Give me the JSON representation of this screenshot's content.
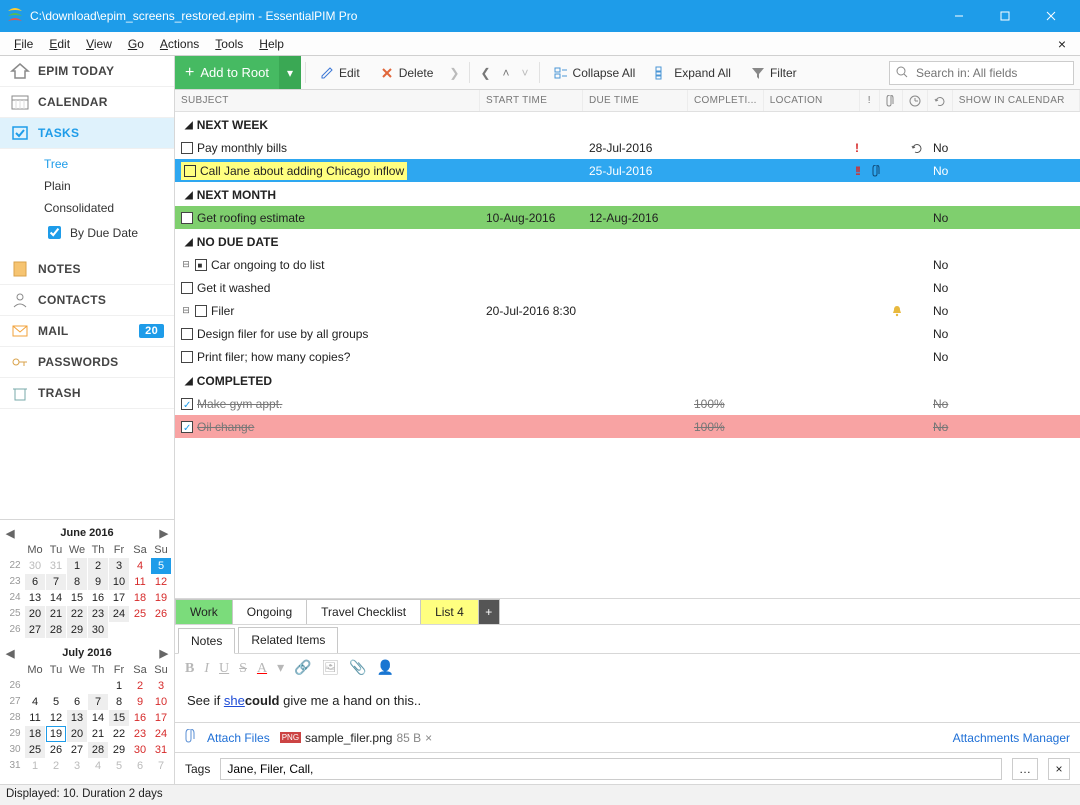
{
  "title": "C:\\download\\epim_screens_restored.epim - EssentialPIM Pro",
  "menu": [
    "File",
    "Edit",
    "View",
    "Go",
    "Actions",
    "Tools",
    "Help"
  ],
  "nav": {
    "items": [
      {
        "label": "EPIM TODAY"
      },
      {
        "label": "CALENDAR"
      },
      {
        "label": "TASKS"
      },
      {
        "label": "NOTES"
      },
      {
        "label": "CONTACTS"
      },
      {
        "label": "MAIL"
      },
      {
        "label": "PASSWORDS"
      },
      {
        "label": "TRASH"
      }
    ],
    "mail_badge": "20",
    "tasks_sub": [
      "Tree",
      "Plain",
      "Consolidated"
    ],
    "tasks_chk": "By Due Date"
  },
  "toolbar": {
    "add": "Add to Root",
    "edit": "Edit",
    "del": "Delete",
    "collapse": "Collapse All",
    "expand": "Expand All",
    "filter": "Filter",
    "search_ph": "Search in: All fields"
  },
  "cols": [
    "SUBJECT",
    "START TIME",
    "DUE TIME",
    "COMPLETI...",
    "LOCATION",
    "SHOW IN CALENDAR"
  ],
  "groups": {
    "nextweek": "NEXT WEEK",
    "nextmonth": "NEXT MONTH",
    "nodue": "NO DUE DATE",
    "completed": "COMPLETED"
  },
  "rows": {
    "r1": {
      "sub": "Pay monthly bills",
      "due": "28-Jul-2016",
      "show": "No"
    },
    "r2": {
      "sub": "Call Jane about adding Chicago inflow",
      "due": "25-Jul-2016",
      "show": "No"
    },
    "r3": {
      "sub": "Get roofing estimate",
      "start": "10-Aug-2016",
      "due": "12-Aug-2016",
      "show": "No"
    },
    "r4": {
      "sub": "Car ongoing to do list",
      "show": "No"
    },
    "r5": {
      "sub": "Get it washed",
      "show": "No"
    },
    "r6": {
      "sub": "Filer",
      "start": "20-Jul-2016 8:30",
      "show": "No"
    },
    "r7": {
      "sub": "Design filer for use by all groups",
      "show": "No"
    },
    "r8": {
      "sub": "Print filer; how many copies?",
      "show": "No"
    },
    "r9": {
      "sub": "Make gym appt.",
      "comp": "100%",
      "show": "No"
    },
    "r10": {
      "sub": "Oil change",
      "comp": "100%",
      "show": "No"
    }
  },
  "list_tabs": [
    "Work",
    "Ongoing",
    "Travel Checklist",
    "List 4"
  ],
  "detail_tabs": [
    "Notes",
    "Related Items"
  ],
  "note": {
    "pre": "See if ",
    "link": "she",
    "bold": "could",
    "post": " give me a hand on this.."
  },
  "attach": {
    "link": "Attach Files",
    "file": "sample_filer.png",
    "size": "85 B",
    "mgr": "Attachments Manager"
  },
  "tags": {
    "label": "Tags",
    "value": "Jane, Filer, Call,"
  },
  "status": "Displayed: 10. Duration 2 days",
  "cal": {
    "m1": "June  2016",
    "m2": "July  2016",
    "dow": [
      "Mo",
      "Tu",
      "We",
      "Th",
      "Fr",
      "Sa",
      "Su"
    ]
  }
}
